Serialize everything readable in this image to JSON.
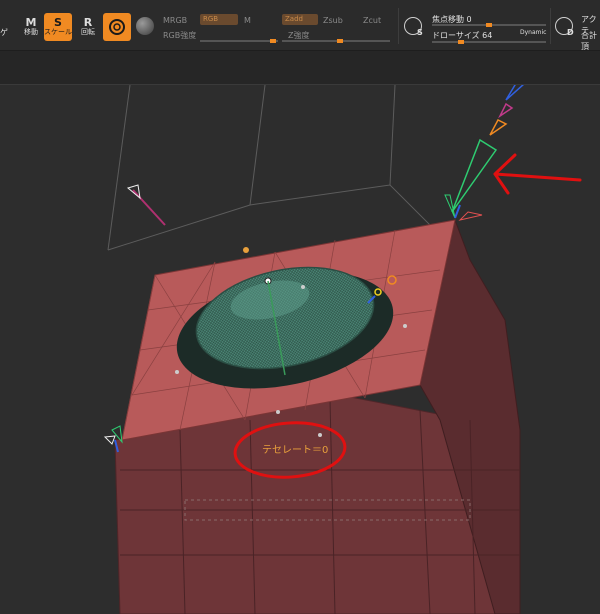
{
  "toolbar": {
    "buttons": [
      {
        "key": "ge",
        "glyph": "",
        "label": "ゲ"
      },
      {
        "key": "move",
        "glyph": "M",
        "label": "移動"
      },
      {
        "key": "scale",
        "glyph": "S",
        "label": "スケール"
      },
      {
        "key": "rotate",
        "glyph": "R",
        "label": "回転"
      }
    ],
    "mrgb": "MRGB",
    "rgb": "RGB",
    "m": "M",
    "zadd": "Zadd",
    "zsub": "Zsub",
    "zcut": "Zcut",
    "rgb_intensity": "RGB強度",
    "z_intensity": "Z強度",
    "focal_shift_label": "焦点移動 0",
    "focal_shift_value": 0,
    "draw_size_label": "ドローサイズ 64",
    "draw_size_value": 64,
    "dynamic": "Dynamic",
    "s_letter": "S",
    "d_letter": "D",
    "right_top": "アクテ",
    "right_bottom": "合計頂"
  },
  "viewport": {
    "tessellate_label": "テセレート＝0"
  },
  "colors": {
    "accent": "#f08a22",
    "mesh_red": "#b85a5a",
    "mesh_green": "#4a7f6f",
    "annotation_red": "#e01010"
  }
}
